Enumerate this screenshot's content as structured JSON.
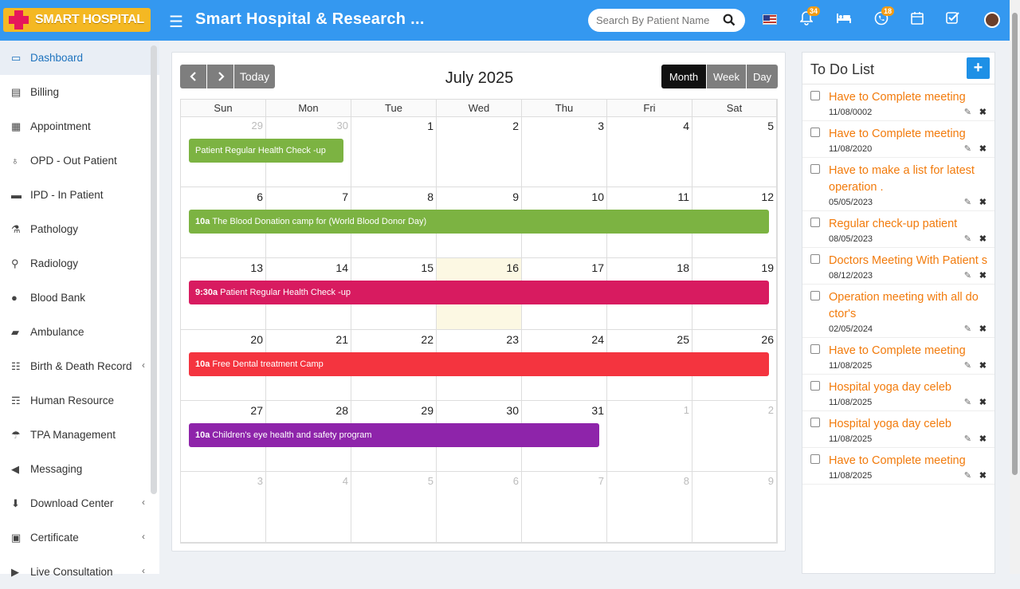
{
  "header": {
    "logo_text": "SMART HOSPITAL",
    "app_title": "Smart Hospital & Research ...",
    "search_placeholder": "Search By Patient Name",
    "notification_count": "34",
    "message_count": "18",
    "brand_color": "#3498f0",
    "logo_color": "#f4b823"
  },
  "sidebar": {
    "items": [
      {
        "label": "Dashboard",
        "icon": "monitor-icon",
        "active": true
      },
      {
        "label": "Billing",
        "icon": "receipt-icon"
      },
      {
        "label": "Appointment",
        "icon": "calendar-check-icon"
      },
      {
        "label": "OPD - Out Patient",
        "icon": "stethoscope-icon"
      },
      {
        "label": "IPD - In Patient",
        "icon": "bed-icon"
      },
      {
        "label": "Pathology",
        "icon": "flask-icon"
      },
      {
        "label": "Radiology",
        "icon": "microscope-icon"
      },
      {
        "label": "Blood Bank",
        "icon": "drop-icon"
      },
      {
        "label": "Ambulance",
        "icon": "ambulance-icon"
      },
      {
        "label": "Birth & Death Record",
        "icon": "people-icon",
        "chevron": true
      },
      {
        "label": "Human Resource",
        "icon": "sitemap-icon"
      },
      {
        "label": "TPA Management",
        "icon": "umbrella-icon"
      },
      {
        "label": "Messaging",
        "icon": "megaphone-icon"
      },
      {
        "label": "Download Center",
        "icon": "download-icon",
        "chevron": true
      },
      {
        "label": "Certificate",
        "icon": "certificate-icon",
        "chevron": true
      },
      {
        "label": "Live Consultation",
        "icon": "video-icon",
        "chevron": true
      }
    ]
  },
  "calendar": {
    "prev_label": "‹",
    "next_label": "›",
    "today_label": "Today",
    "title": "July 2025",
    "view_month": "Month",
    "view_week": "Week",
    "view_day": "Day",
    "days_of_week": [
      "Sun",
      "Mon",
      "Tue",
      "Wed",
      "Thu",
      "Fri",
      "Sat"
    ],
    "weeks": [
      [
        {
          "d": "29",
          "o": true
        },
        {
          "d": "30",
          "o": true
        },
        {
          "d": "1"
        },
        {
          "d": "2"
        },
        {
          "d": "3"
        },
        {
          "d": "4"
        },
        {
          "d": "5"
        }
      ],
      [
        {
          "d": "6"
        },
        {
          "d": "7"
        },
        {
          "d": "8"
        },
        {
          "d": "9"
        },
        {
          "d": "10"
        },
        {
          "d": "11"
        },
        {
          "d": "12"
        }
      ],
      [
        {
          "d": "13"
        },
        {
          "d": "14"
        },
        {
          "d": "15"
        },
        {
          "d": "16",
          "today": true
        },
        {
          "d": "17"
        },
        {
          "d": "18"
        },
        {
          "d": "19"
        }
      ],
      [
        {
          "d": "20"
        },
        {
          "d": "21"
        },
        {
          "d": "22"
        },
        {
          "d": "23"
        },
        {
          "d": "24"
        },
        {
          "d": "25"
        },
        {
          "d": "26"
        }
      ],
      [
        {
          "d": "27"
        },
        {
          "d": "28"
        },
        {
          "d": "29"
        },
        {
          "d": "30"
        },
        {
          "d": "31"
        },
        {
          "d": "1",
          "o": true
        },
        {
          "d": "2",
          "o": true
        }
      ],
      [
        {
          "d": "3",
          "o": true
        },
        {
          "d": "4",
          "o": true
        },
        {
          "d": "5",
          "o": true
        },
        {
          "d": "6",
          "o": true
        },
        {
          "d": "7",
          "o": true
        },
        {
          "d": "8",
          "o": true
        },
        {
          "d": "9",
          "o": true
        }
      ]
    ],
    "events": [
      {
        "week": 0,
        "start_col": 0,
        "span": 2,
        "time": "",
        "title": "Patient Regular Health Check -up",
        "color": "#7cb342"
      },
      {
        "week": 1,
        "start_col": 0,
        "span": 7,
        "time": "10a",
        "title": "The Blood Donation camp for (World Blood Donor Day)",
        "color": "#7cb342"
      },
      {
        "week": 2,
        "start_col": 0,
        "span": 7,
        "time": "9:30a",
        "title": "Patient Regular Health Check -up",
        "color": "#d81b60"
      },
      {
        "week": 3,
        "start_col": 0,
        "span": 7,
        "time": "10a",
        "title": "Free Dental treatment Camp",
        "color": "#f4343f"
      },
      {
        "week": 4,
        "start_col": 0,
        "span": 5,
        "time": "10a",
        "title": "Children's eye health and safety program",
        "color": "#8e24aa"
      }
    ]
  },
  "todo": {
    "title": "To Do List",
    "add_label": "+",
    "items": [
      {
        "text": "Have to Complete meeting",
        "date": "11/08/0002"
      },
      {
        "text": "Have to Complete meeting",
        "date": "11/08/2020"
      },
      {
        "text": "Have to make a list for latest operation .",
        "date": "05/05/2023"
      },
      {
        "text": "Regular check-up patient",
        "date": "08/05/2023"
      },
      {
        "text": "Doctors Meeting With Patient s",
        "date": "08/12/2023"
      },
      {
        "text": "Operation meeting with all do ctor's",
        "date": "02/05/2024"
      },
      {
        "text": "Have to Complete meeting",
        "date": "11/08/2025"
      },
      {
        "text": "Hospital yoga day celeb",
        "date": "11/08/2025"
      },
      {
        "text": "Hospital yoga day celeb",
        "date": "11/08/2025"
      },
      {
        "text": "Have to Complete meeting",
        "date": "11/08/2025"
      }
    ]
  }
}
